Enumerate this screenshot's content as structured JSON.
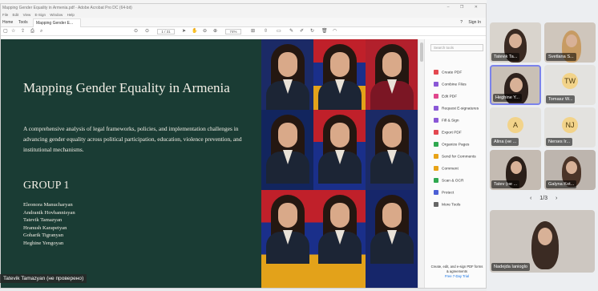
{
  "acrobat": {
    "title": "Mapping Gender Equality in Armenia.pdf - Adobe Acrobat Pro DC (64-bit)",
    "menu": [
      "File",
      "Edit",
      "View",
      "E-Sign",
      "Window",
      "Help"
    ],
    "tabs": {
      "home": "Home",
      "tools": "Tools",
      "document": "Mapping Gender E..."
    },
    "header_right": {
      "help": "?",
      "sign_in": "Sign In"
    },
    "page_current": "1",
    "page_total": "/ 31",
    "zoom": "74%",
    "search_placeholder": "Search tools",
    "tools": [
      {
        "label": "Create PDF",
        "color": "#e34850"
      },
      {
        "label": "Combine Files",
        "color": "#8a57d6"
      },
      {
        "label": "Edit PDF",
        "color": "#e0468d"
      },
      {
        "label": "Request E-signatures",
        "color": "#8a57d6"
      },
      {
        "label": "Fill & Sign",
        "color": "#8a57d6"
      },
      {
        "label": "Export PDF",
        "color": "#e34850"
      },
      {
        "label": "Organize Pages",
        "color": "#2fa84f"
      },
      {
        "label": "Send for Comments",
        "color": "#e8a317"
      },
      {
        "label": "Comment",
        "color": "#e8a317"
      },
      {
        "label": "Scan & OCR",
        "color": "#2fa84f"
      },
      {
        "label": "Protect",
        "color": "#4c5fd5"
      },
      {
        "label": "More Tools",
        "color": "#666666"
      }
    ],
    "promo": "Create, edit, and e-sign PDF forms & agreements",
    "trial": "Free 7-Day Trial"
  },
  "slide": {
    "title": "Mapping Gender Equality in Armenia",
    "description": "A comprehensive analysis of legal frameworks, policies, and implementation challenges in advancing gender equality across political participation, education, violence prevention, and institutional mechanisms.",
    "group": "GROUP 1",
    "members": [
      "Eleonora Manucharyan",
      "Andranik Hovhannisyan",
      "Tatevik Tamazyan",
      "Hranush Karapetyan",
      "Goharik Tigranyan",
      "Heghine Yengoyan"
    ]
  },
  "presenter_label": "Tatevik Tamazyan (не проверено)",
  "participants": [
    {
      "name": "Tatevik Ta...",
      "kind": "camera"
    },
    {
      "name": "Svetlana S...",
      "kind": "camera"
    },
    {
      "name": "Heghine Y...",
      "kind": "camera",
      "selected": true
    },
    {
      "name": "Tomasz W...",
      "kind": "avatar",
      "initials": "TW"
    },
    {
      "name": "Alina (не ...",
      "kind": "avatar",
      "initials": "A"
    },
    {
      "name": "Nerses Ir...",
      "kind": "avatar",
      "initials": "NJ"
    },
    {
      "name": "Tatev (не ...",
      "kind": "camera"
    },
    {
      "name": "Galyna Kot...",
      "kind": "camera"
    },
    {
      "name": "Nadejda Ianioglo",
      "kind": "camera"
    }
  ],
  "pager": {
    "label": "1/3",
    "prev": "‹",
    "next": "›"
  }
}
